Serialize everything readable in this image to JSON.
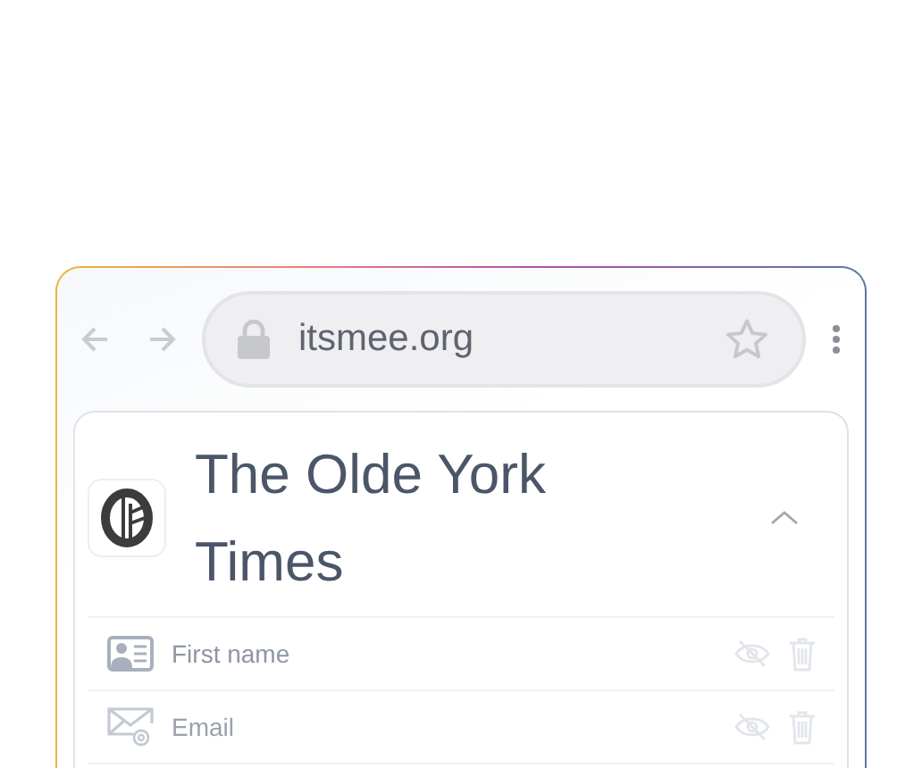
{
  "browser": {
    "address": "itsmee.org",
    "bookmarked": false
  },
  "site": {
    "name": "The Olde York Times",
    "expanded": true
  },
  "fields": [
    {
      "kind": "name",
      "label": "First name"
    },
    {
      "kind": "email",
      "label": "Email"
    }
  ]
}
